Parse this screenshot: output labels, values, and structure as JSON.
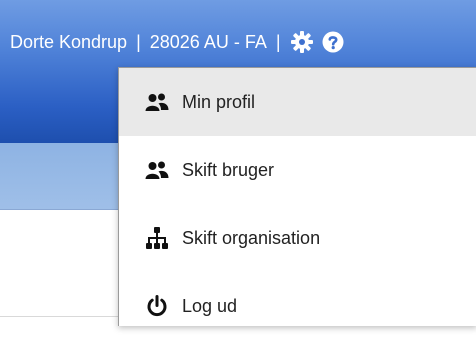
{
  "header": {
    "user_name": "Dorte Kondrup",
    "separator": "|",
    "organization": "28026 AU - FA",
    "settings_icon": "gear-icon",
    "help_icon": "question-circle-icon"
  },
  "colors": {
    "header_top": "#6f9ce3",
    "header_bottom": "#1e4fae",
    "subbar": "#9fbfe8",
    "menu_hover": "#e9e9e9"
  },
  "menu": {
    "items": [
      {
        "label": "Min profil",
        "icon": "users-icon",
        "active": true
      },
      {
        "label": "Skift bruger",
        "icon": "users-icon",
        "active": false
      },
      {
        "label": "Skift organisation",
        "icon": "org-chart-icon",
        "active": false
      },
      {
        "label": "Log ud",
        "icon": "power-icon",
        "active": false
      }
    ]
  }
}
